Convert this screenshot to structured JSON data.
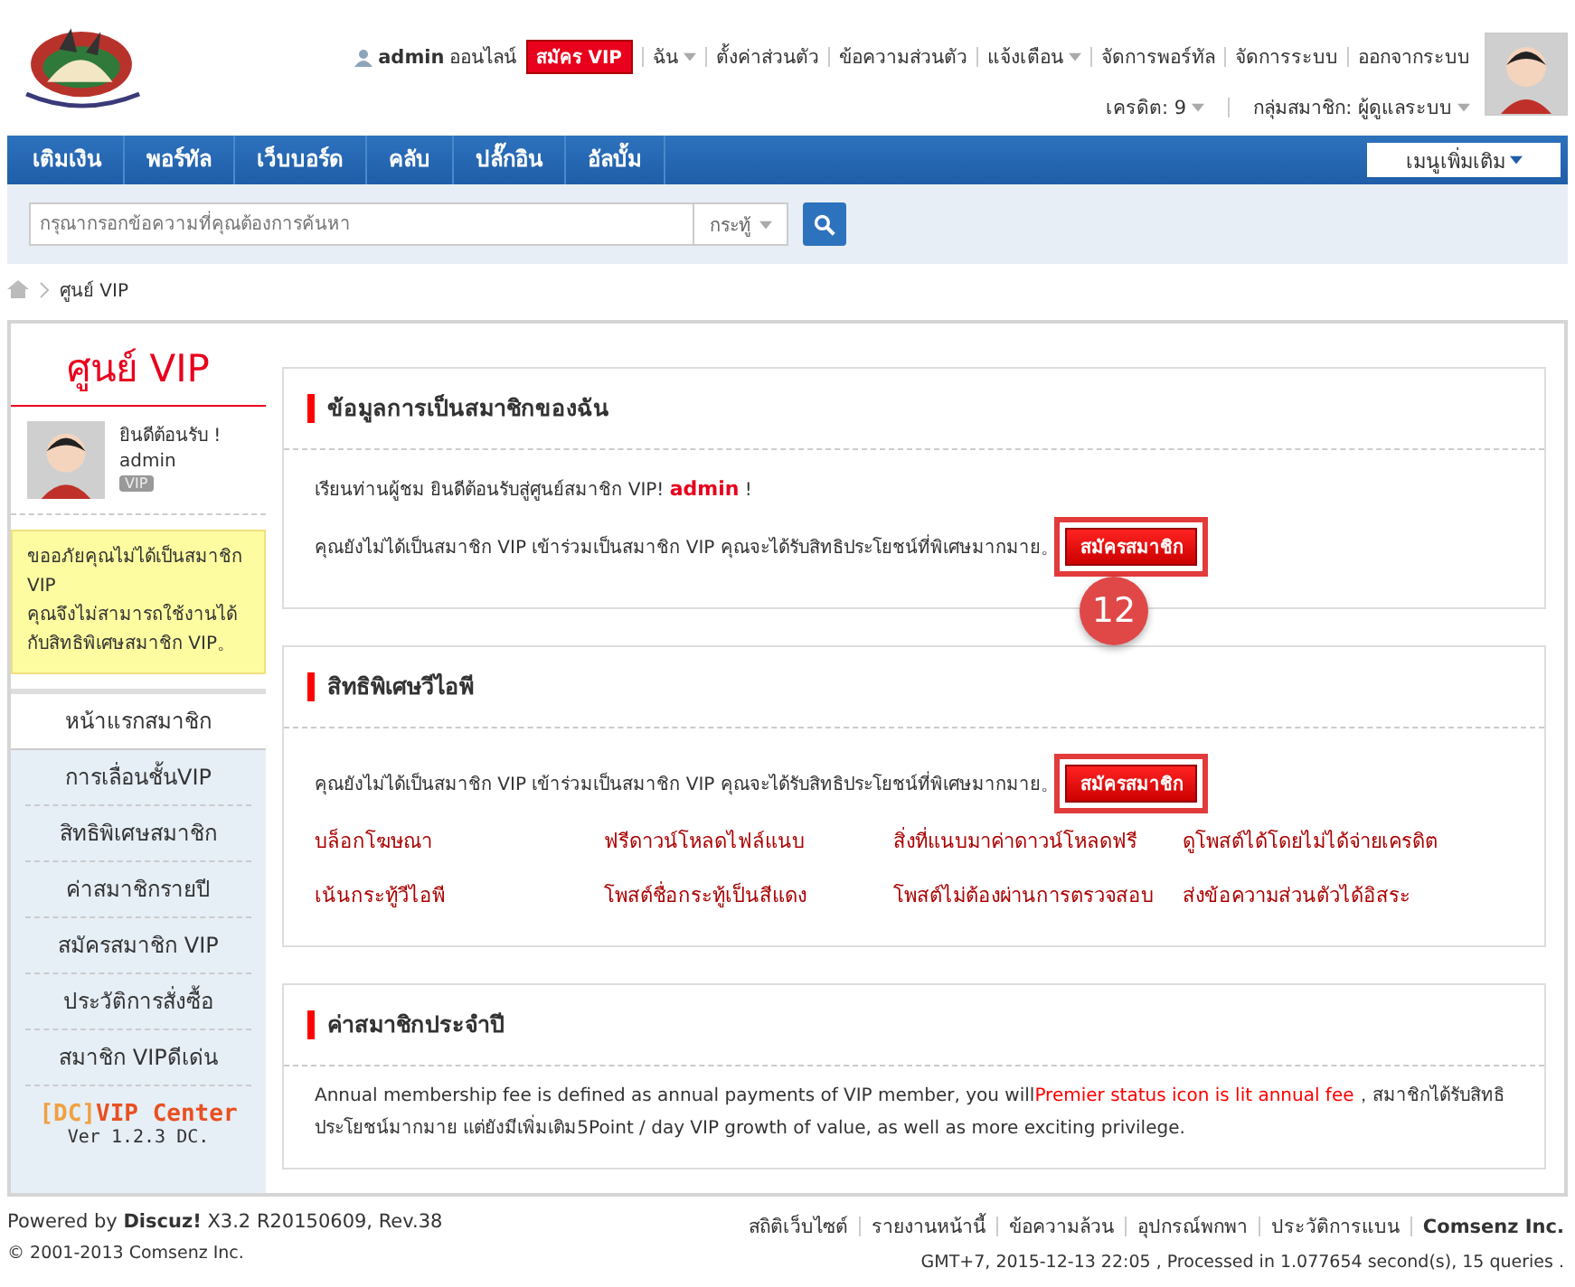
{
  "header": {
    "user": "admin",
    "status": "ออนไลน์",
    "vip_button": "สมัคร VIP",
    "links": [
      {
        "label": "ฉัน",
        "dropdown": true
      },
      {
        "label": "ตั้งค่าส่วนตัว",
        "dropdown": false
      },
      {
        "label": "ข้อความส่วนตัว",
        "dropdown": false
      },
      {
        "label": "แจ้งเตือน",
        "dropdown": true
      },
      {
        "label": "จัดการพอร์ทัล",
        "dropdown": false
      },
      {
        "label": "จัดการระบบ",
        "dropdown": false
      },
      {
        "label": "ออกจากระบบ",
        "dropdown": false
      }
    ],
    "info": [
      {
        "label": "เครดิต: 9",
        "dropdown": true
      },
      {
        "label": "กลุ่มสมาชิก: ผู้ดูแลระบบ",
        "dropdown": true
      }
    ]
  },
  "nav": {
    "items": [
      "เติมเงิน",
      "พอร์ทัล",
      "เว็บบอร์ด",
      "คลับ",
      "ปลั๊กอิน",
      "อัลบั้ม"
    ],
    "more": "เมนูเพิ่มเติม"
  },
  "search": {
    "placeholder": "กรุณากรอกข้อความที่คุณต้องการค้นหา",
    "scope": "กระทู้"
  },
  "breadcrumb": [
    "ศูนย์ VIP"
  ],
  "sidebar": {
    "title": "ศูนย์ VIP",
    "welcome": "ยินดีต้อนรับ !",
    "username": "admin",
    "badge": "VIP",
    "notice": "ขออภัยคุณไม่ได้เป็นสมาชิก VIP\nคุณจึงไม่สามารถใช้งานได้กับสิทธิพิเศษสมาชิก VIP。",
    "menu": [
      {
        "label": "หน้าแรกสมาชิก",
        "selected": true
      },
      {
        "label": "การเลื่อนชั้นVIP",
        "selected": false
      },
      {
        "label": "สิทธิพิเศษสมาชิก",
        "selected": false
      },
      {
        "label": "ค่าสมาชิกรายปี",
        "selected": false
      },
      {
        "label": "สมัครสมาชิก VIP",
        "selected": false
      },
      {
        "label": "ประวัติการสั่งซื้อ",
        "selected": false
      },
      {
        "label": "สมาชิก VIPดีเด่น",
        "selected": false
      }
    ],
    "brand_prefix": "[DC]",
    "brand": "VIP Center",
    "version": "Ver 1.2.3 DC."
  },
  "sections": [
    {
      "kind": "info",
      "title": "ข้อมูลการเป็นสมาชิกของฉัน",
      "greeting": "เรียนท่านผู้ชม ยินดีต้อนรับสู่ศูนย์สมาชิก VIP! **admin** !",
      "text": "คุณยังไม่ได้เป็นสมาชิก VIP เข้าร่วมเป็นสมาชิก VIP คุณจะได้รับสิทธิประโยชน์ที่พิเศษมากมาย。",
      "button": "สมัครสมาชิก",
      "highlighted": true
    },
    {
      "kind": "privileges",
      "title": "สิทธิพิเศษวีไอพี",
      "text": "คุณยังไม่ได้เป็นสมาชิก VIP เข้าร่วมเป็นสมาชิก VIP คุณจะได้รับสิทธิประโยชน์ที่พิเศษมากมาย。",
      "button": "สมัครสมาชิก",
      "highlighted": true,
      "items": [
        "บล็อกโฆษณา",
        "ฟรีดาวน์โหลดไฟล์แนบ",
        "สิ่งที่แนบมาค่าดาวน์โหลดฟรี",
        "ดูโพสต์ได้โดยไม่ได้จ่ายเครดิต",
        "เน้นกระทู้วีไอพี",
        "โพสต์ชื่อกระทู้เป็นสีแดง",
        "โพสต์ไม่ต้องผ่านการตรวจสอบ",
        "ส่งข้อความส่วนตัวได้อิสระ"
      ]
    },
    {
      "kind": "fee",
      "title": "ค่าสมาชิกประจำปี",
      "text_before": "Annual membership fee is defined as annual payments of VIP member, you will",
      "highlight": "Premier status icon is lit annual fee",
      "text_after": "，สมาชิกได้รับสิทธิประโยชน์มากมาย แต่ยังมีเพิ่มเติม5Point / day VIP growth of value, as well as more exciting privilege."
    }
  ],
  "annotation": {
    "badge": "12"
  },
  "footer": {
    "powered_label": "Powered by",
    "product": "Discuz!",
    "version": "X3.2 R20150609, Rev.38",
    "copyright": "© 2001-2013 Comsenz Inc.",
    "links": [
      {
        "label": "สถิติเว็บไซต์",
        "bold": false
      },
      {
        "label": "รายงานหน้านี้",
        "bold": false
      },
      {
        "label": "ข้อความล้วน",
        "bold": false
      },
      {
        "label": "อุปกรณ์พกพา",
        "bold": false
      },
      {
        "label": "ประวัติการแบน",
        "bold": false
      },
      {
        "label": "Comsenz Inc.",
        "bold": true
      }
    ],
    "stats": "GMT+7, 2015-12-13 22:05 , Processed in 1.077654 second(s), 15 queries ."
  }
}
